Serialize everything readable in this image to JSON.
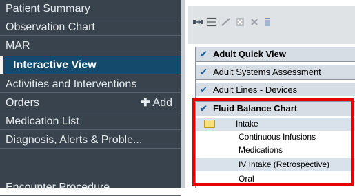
{
  "nav": {
    "items": [
      {
        "label": "Patient Summary"
      },
      {
        "label": "Observation Chart"
      },
      {
        "label": "MAR"
      },
      {
        "label": "Interactive View"
      },
      {
        "label": "Activities and Interventions"
      },
      {
        "label": "Orders"
      },
      {
        "label": "Medication List"
      },
      {
        "label": "Diagnosis, Alerts & Proble..."
      },
      {
        "label": "Encounter Procedure"
      }
    ],
    "orders_add_label": "Add",
    "active_index": 3
  },
  "toolbar": {
    "icons": [
      "bookmark-arrow-icon",
      "table-icon",
      "checkmark-icon",
      "clear-icon",
      "close-x-icon",
      "trash-icon"
    ]
  },
  "tree": {
    "sections": [
      {
        "label": "Adult Quick View",
        "bold": true
      },
      {
        "label": "Adult Systems Assessment",
        "bold": false
      },
      {
        "label": "Adult Lines - Devices",
        "bold": false
      },
      {
        "label": "Fluid Balance Chart",
        "bold": true
      }
    ],
    "intake_label": "Intake",
    "rows": [
      {
        "label": "Continuous Infusions"
      },
      {
        "label": "Medications"
      },
      {
        "label": "IV Intake (Retrospective)"
      },
      {
        "label": "Oral"
      }
    ]
  },
  "colors": {
    "nav_bg": "#39434d",
    "nav_active": "#144a6b",
    "highlight": "#e60000",
    "section_bg": "#d6dde4"
  }
}
